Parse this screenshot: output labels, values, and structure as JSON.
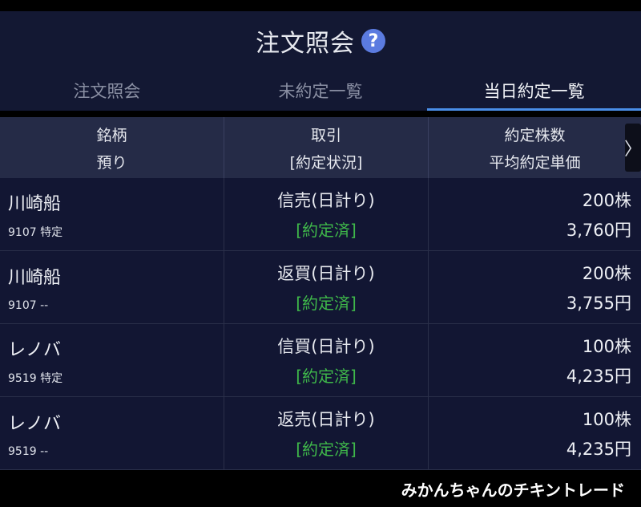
{
  "title": {
    "text": "注文照会",
    "help_icon": "?"
  },
  "tabs": [
    {
      "label": "注文照会",
      "active": false
    },
    {
      "label": "未約定一覧",
      "active": false
    },
    {
      "label": "当日約定一覧",
      "active": true
    }
  ],
  "header": {
    "col1_line1": "銘柄",
    "col1_line2": "預り",
    "col2_line1": "取引",
    "col2_line2": "[約定状況]",
    "col3_line1": "約定株数",
    "col3_line2": "平均約定単価",
    "next_icon": "〉"
  },
  "rows": [
    {
      "name": "川崎船",
      "sub": "9107 特定",
      "trade": "信売(日計り)",
      "status": "[約定済]",
      "qty": "200株",
      "price": "3,760円"
    },
    {
      "name": "川崎船",
      "sub": "9107 --",
      "trade": "返買(日計り)",
      "status": "[約定済]",
      "qty": "200株",
      "price": "3,755円"
    },
    {
      "name": "レノバ",
      "sub": "9519 特定",
      "trade": "信買(日計り)",
      "status": "[約定済]",
      "qty": "100株",
      "price": "4,235円"
    },
    {
      "name": "レノバ",
      "sub": "9519 --",
      "trade": "返売(日計り)",
      "status": "[約定済]",
      "qty": "100株",
      "price": "4,235円"
    }
  ],
  "watermark": "みかんちゃんのチキントレード",
  "colors": {
    "accent": "#4a8ee8",
    "status": "#3fb84a",
    "help": "#5b7be0"
  }
}
